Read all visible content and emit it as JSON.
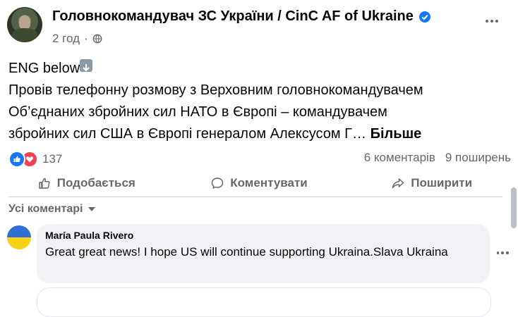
{
  "post": {
    "author": "Головнокомандувач ЗС України / CinC AF of Ukraine",
    "time": "2 год",
    "text_lines": [
      "ENG below",
      "Провів телефонну розмову з Верховним головнокомандувачем",
      "Об’єднаних збройних сил НАТО в Європі – командувачем",
      "збройних сил США в Європі генералом Алексусом Г…"
    ],
    "see_more": "Більше",
    "reaction_count": "137",
    "comments_count": "6 коментарів",
    "shares_count": "9 поширень"
  },
  "actions": {
    "like": "Подобається",
    "comment": "Коментувати",
    "share": "Поширити"
  },
  "comments": {
    "filter": "Усі коментарі",
    "items": [
      {
        "author": "María Paula Rivero",
        "text": "Great great news! I hope US will continue supporting Ukraina.Slava Ukraina"
      }
    ]
  },
  "icons": {
    "verified": "verified-badge-icon",
    "privacy": "globe-icon",
    "like_reaction": "like-reaction-icon",
    "love_reaction": "love-reaction-icon"
  },
  "colors": {
    "accent": "#1877f2",
    "love": "#f33e58",
    "secondary_text": "#65676b",
    "comment_bg": "#f0f2f5"
  }
}
